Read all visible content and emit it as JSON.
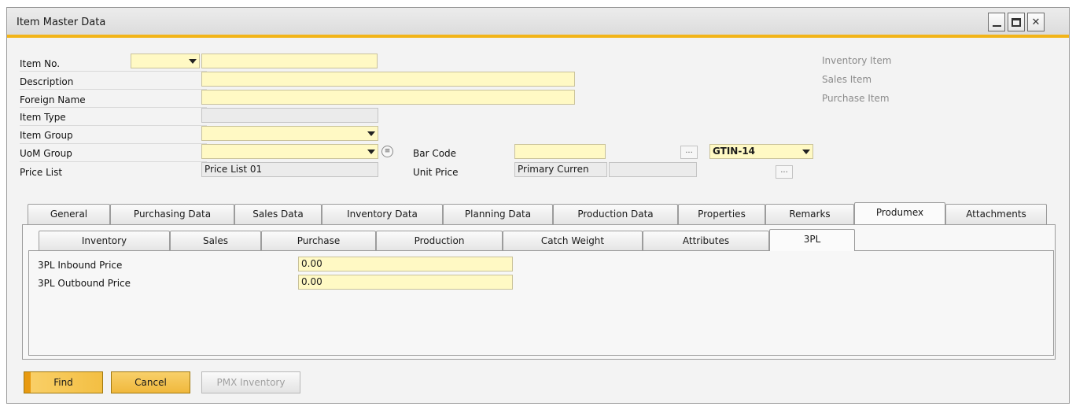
{
  "window": {
    "title": "Item Master Data"
  },
  "header": {
    "item_no_label": "Item No.",
    "item_no_series": "",
    "item_no_value": "",
    "description_label": "Description",
    "description_value": "",
    "foreign_name_label": "Foreign Name",
    "foreign_name_value": "",
    "item_type_label": "Item Type",
    "item_type_value": "",
    "item_group_label": "Item Group",
    "item_group_value": "",
    "uom_group_label": "UoM Group",
    "uom_group_value": "",
    "price_list_label": "Price List",
    "price_list_value": "Price List 01",
    "bar_code_label": "Bar Code",
    "bar_code_value": "",
    "bar_code_type": "GTIN-14",
    "unit_price_label": "Unit Price",
    "unit_price_currency": "Primary Curren",
    "unit_price_value": "",
    "inventory_item": "Inventory Item",
    "sales_item": "Sales Item",
    "purchase_item": "Purchase Item"
  },
  "tabs": [
    {
      "label": "General"
    },
    {
      "label": "Purchasing Data"
    },
    {
      "label": "Sales Data"
    },
    {
      "label": "Inventory Data"
    },
    {
      "label": "Planning Data"
    },
    {
      "label": "Production Data"
    },
    {
      "label": "Properties"
    },
    {
      "label": "Remarks"
    },
    {
      "label": "Produmex"
    },
    {
      "label": "Attachments"
    }
  ],
  "subtabs": [
    {
      "label": "Inventory"
    },
    {
      "label": "Sales"
    },
    {
      "label": "Purchase"
    },
    {
      "label": "Production"
    },
    {
      "label": "Catch Weight"
    },
    {
      "label": "Attributes"
    },
    {
      "label": "3PL"
    }
  ],
  "threepl": {
    "inbound_label": "3PL Inbound Price",
    "inbound_value": "0.00",
    "outbound_label": "3PL Outbound Price",
    "outbound_value": "0.00"
  },
  "footer": {
    "find": "Find",
    "cancel": "Cancel",
    "pmx_inventory": "PMX Inventory"
  },
  "colors": {
    "accent": "#f2b418",
    "field_yellow": "#fff9c4",
    "field_grey": "#ebebeb"
  }
}
